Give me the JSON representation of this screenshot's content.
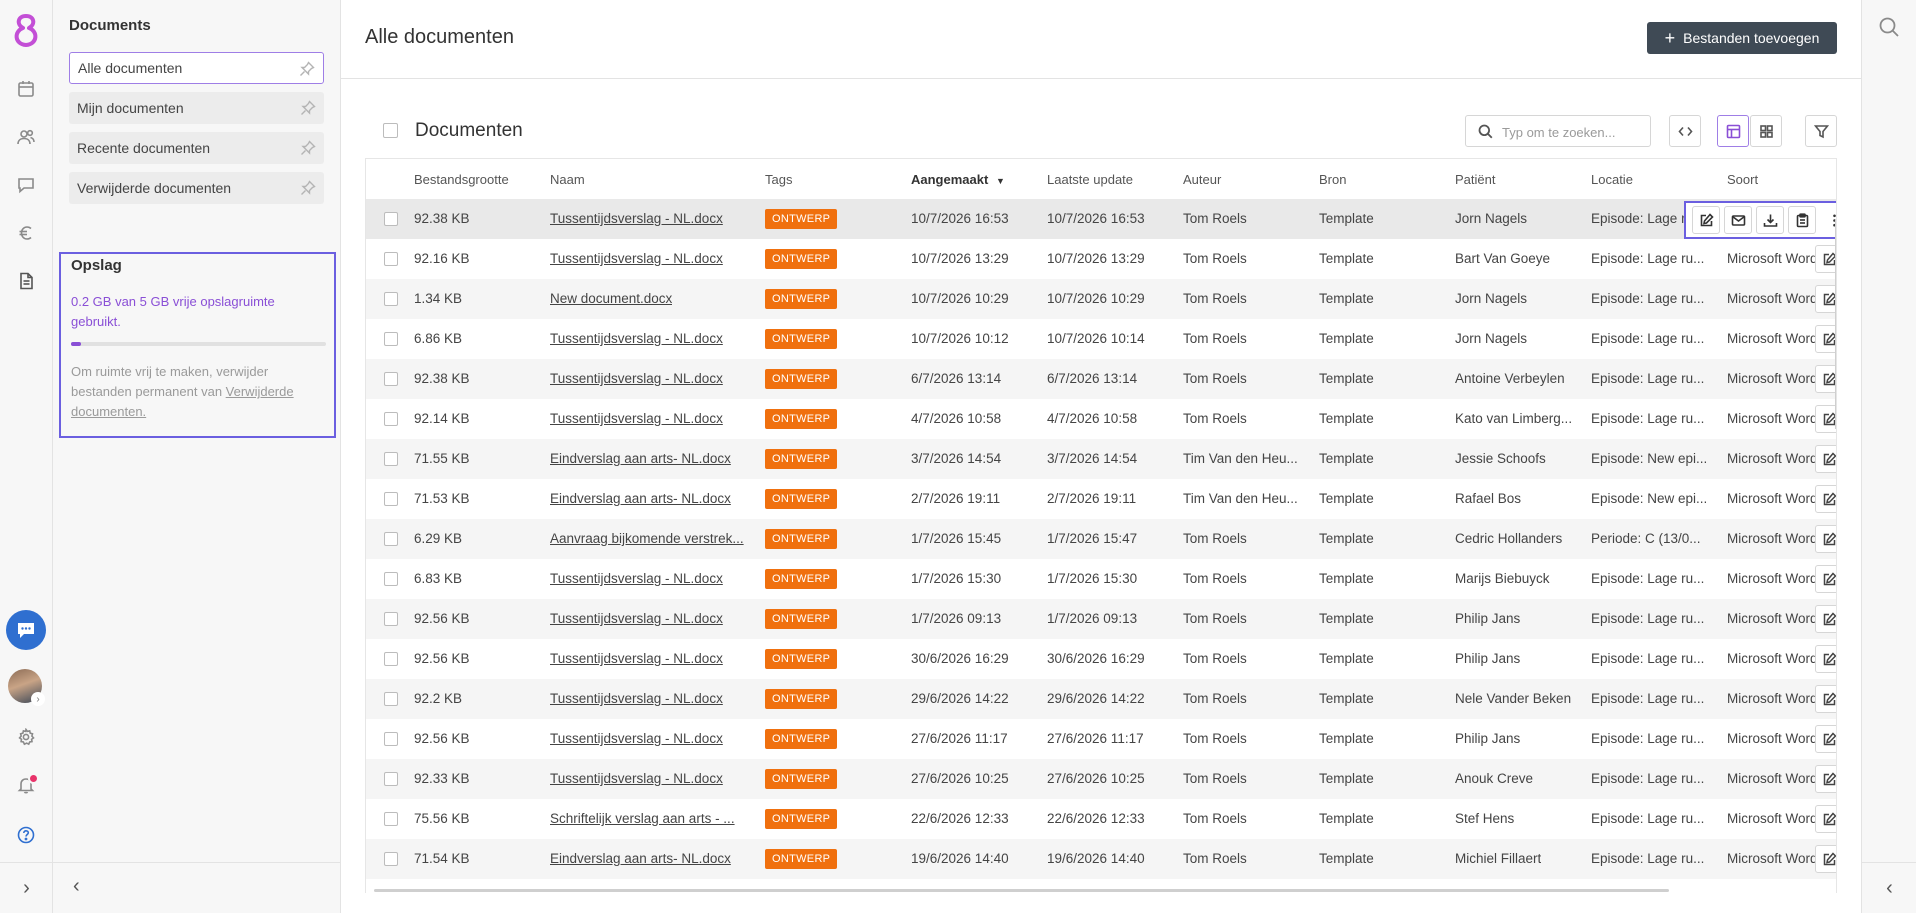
{
  "sidebar": {
    "title": "Documents",
    "items": [
      {
        "label": "Alle documenten",
        "active": true
      },
      {
        "label": "Mijn documenten",
        "active": false
      },
      {
        "label": "Recente documenten",
        "active": false
      },
      {
        "label": "Verwijderde documenten",
        "active": false
      }
    ]
  },
  "storage": {
    "title": "Opslag",
    "used_text": "0.2 GB van 5 GB vrije opslagruimte gebruikt.",
    "used_fraction": 0.04,
    "note_prefix": "Om ruimte vrij te maken, verwijder bestanden permanent van ",
    "note_link": "Verwijderde documenten."
  },
  "header": {
    "title": "Alle documenten",
    "add_button": "Bestanden toevoegen"
  },
  "section": {
    "title": "Documenten",
    "search_placeholder": "Typ om te zoeken..."
  },
  "table": {
    "columns": [
      "Bestandsgrootte",
      "Naam",
      "Tags",
      "Aangemaakt",
      "Laatste update",
      "Auteur",
      "Bron",
      "Patiënt",
      "Locatie",
      "Soort"
    ],
    "sorted_column": "Aangemaakt",
    "sort_direction": "descending",
    "rows": [
      {
        "size": "92.38 KB",
        "name": "Tussentijdsverslag - NL.docx",
        "tag": "ONTWERP",
        "created": "10/7/2026 16:53",
        "updated": "10/7/2026 16:53",
        "author": "Tom Roels",
        "source": "Template",
        "patient": "Jorn Nagels",
        "location": "Episode: Lage ru...",
        "type": ""
      },
      {
        "size": "92.16 KB",
        "name": "Tussentijdsverslag - NL.docx",
        "tag": "ONTWERP",
        "created": "10/7/2026 13:29",
        "updated": "10/7/2026 13:29",
        "author": "Tom Roels",
        "source": "Template",
        "patient": "Bart Van Goeye",
        "location": "Episode: Lage ru...",
        "type": "Microsoft Word ..."
      },
      {
        "size": "1.34 KB",
        "name": "New document.docx",
        "tag": "ONTWERP",
        "created": "10/7/2026 10:29",
        "updated": "10/7/2026 10:29",
        "author": "Tom Roels",
        "source": "Template",
        "patient": "Jorn Nagels",
        "location": "Episode: Lage ru...",
        "type": "Microsoft Word ..."
      },
      {
        "size": "6.86 KB",
        "name": "Tussentijdsverslag - NL.docx",
        "tag": "ONTWERP",
        "created": "10/7/2026 10:12",
        "updated": "10/7/2026 10:14",
        "author": "Tom Roels",
        "source": "Template",
        "patient": "Jorn Nagels",
        "location": "Episode: Lage ru...",
        "type": "Microsoft Word ..."
      },
      {
        "size": "92.38 KB",
        "name": "Tussentijdsverslag - NL.docx",
        "tag": "ONTWERP",
        "created": "6/7/2026 13:14",
        "updated": "6/7/2026 13:14",
        "author": "Tom Roels",
        "source": "Template",
        "patient": "Antoine Verbeylen",
        "location": "Episode: Lage ru...",
        "type": "Microsoft Word ..."
      },
      {
        "size": "92.14 KB",
        "name": "Tussentijdsverslag - NL.docx",
        "tag": "ONTWERP",
        "created": "4/7/2026 10:58",
        "updated": "4/7/2026 10:58",
        "author": "Tom Roels",
        "source": "Template",
        "patient": "Kato van Limberg...",
        "location": "Episode: Lage ru...",
        "type": "Microsoft Word ..."
      },
      {
        "size": "71.55 KB",
        "name": "Eindverslag aan arts- NL.docx",
        "tag": "ONTWERP",
        "created": "3/7/2026 14:54",
        "updated": "3/7/2026 14:54",
        "author": "Tim Van den Heu...",
        "source": "Template",
        "patient": "Jessie Schoofs",
        "location": "Episode: New epi...",
        "type": "Microsoft Word ..."
      },
      {
        "size": "71.53 KB",
        "name": "Eindverslag aan arts- NL.docx",
        "tag": "ONTWERP",
        "created": "2/7/2026 19:11",
        "updated": "2/7/2026 19:11",
        "author": "Tim Van den Heu...",
        "source": "Template",
        "patient": "Rafael Bos",
        "location": "Episode: New epi...",
        "type": "Microsoft Word ..."
      },
      {
        "size": "6.29 KB",
        "name": "Aanvraag bijkomende verstrek...",
        "tag": "ONTWERP",
        "created": "1/7/2026 15:45",
        "updated": "1/7/2026 15:47",
        "author": "Tom Roels",
        "source": "Template",
        "patient": "Cedric Hollanders",
        "location": "Periode: C (13/0...",
        "type": "Microsoft Word ..."
      },
      {
        "size": "6.83 KB",
        "name": "Tussentijdsverslag - NL.docx",
        "tag": "ONTWERP",
        "created": "1/7/2026 15:30",
        "updated": "1/7/2026 15:30",
        "author": "Tom Roels",
        "source": "Template",
        "patient": "Marijs Biebuyck",
        "location": "Episode: Lage ru...",
        "type": "Microsoft Word ..."
      },
      {
        "size": "92.56 KB",
        "name": "Tussentijdsverslag - NL.docx",
        "tag": "ONTWERP",
        "created": "1/7/2026 09:13",
        "updated": "1/7/2026 09:13",
        "author": "Tom Roels",
        "source": "Template",
        "patient": "Philip Jans",
        "location": "Episode: Lage ru...",
        "type": "Microsoft Word ..."
      },
      {
        "size": "92.56 KB",
        "name": "Tussentijdsverslag - NL.docx",
        "tag": "ONTWERP",
        "created": "30/6/2026 16:29",
        "updated": "30/6/2026 16:29",
        "author": "Tom Roels",
        "source": "Template",
        "patient": "Philip Jans",
        "location": "Episode: Lage ru...",
        "type": "Microsoft Word ..."
      },
      {
        "size": "92.2 KB",
        "name": "Tussentijdsverslag - NL.docx",
        "tag": "ONTWERP",
        "created": "29/6/2026 14:22",
        "updated": "29/6/2026 14:22",
        "author": "Tom Roels",
        "source": "Template",
        "patient": "Nele Vander Beken",
        "location": "Episode: Lage ru...",
        "type": "Microsoft Word ..."
      },
      {
        "size": "92.56 KB",
        "name": "Tussentijdsverslag - NL.docx",
        "tag": "ONTWERP",
        "created": "27/6/2026 11:17",
        "updated": "27/6/2026 11:17",
        "author": "Tom Roels",
        "source": "Template",
        "patient": "Philip Jans",
        "location": "Episode: Lage ru...",
        "type": "Microsoft Word ..."
      },
      {
        "size": "92.33 KB",
        "name": "Tussentijdsverslag - NL.docx",
        "tag": "ONTWERP",
        "created": "27/6/2026 10:25",
        "updated": "27/6/2026 10:25",
        "author": "Tom Roels",
        "source": "Template",
        "patient": "Anouk Creve",
        "location": "Episode: Lage ru...",
        "type": "Microsoft Word ..."
      },
      {
        "size": "75.56 KB",
        "name": "Schriftelijk verslag aan arts - ...",
        "tag": "ONTWERP",
        "created": "22/6/2026 12:33",
        "updated": "22/6/2026 12:33",
        "author": "Tom Roels",
        "source": "Template",
        "patient": "Stef Hens",
        "location": "Episode: Lage ru...",
        "type": "Microsoft Word ..."
      },
      {
        "size": "71.54 KB",
        "name": "Eindverslag aan arts- NL.docx",
        "tag": "ONTWERP",
        "created": "19/6/2026 14:40",
        "updated": "19/6/2026 14:40",
        "author": "Tom Roels",
        "source": "Template",
        "patient": "Michiel Fillaert",
        "location": "Episode: Lage ru...",
        "type": "Microsoft Word ..."
      }
    ]
  },
  "colors": {
    "accent": "#8a4fd6",
    "tag": "#f0700e",
    "primary_button": "#3f4a55",
    "highlight": "#6b5fe0",
    "chat": "#2f6fd0",
    "notification": "#e8336a"
  },
  "icons": {
    "rail": [
      "calendar-icon",
      "users-icon",
      "chat-icon",
      "euro-icon",
      "document-icon",
      "settings-icon",
      "bell-icon",
      "help-icon"
    ],
    "row_actions": [
      "edit-icon",
      "mail-icon",
      "download-icon",
      "clipboard-icon",
      "more-icon"
    ]
  }
}
